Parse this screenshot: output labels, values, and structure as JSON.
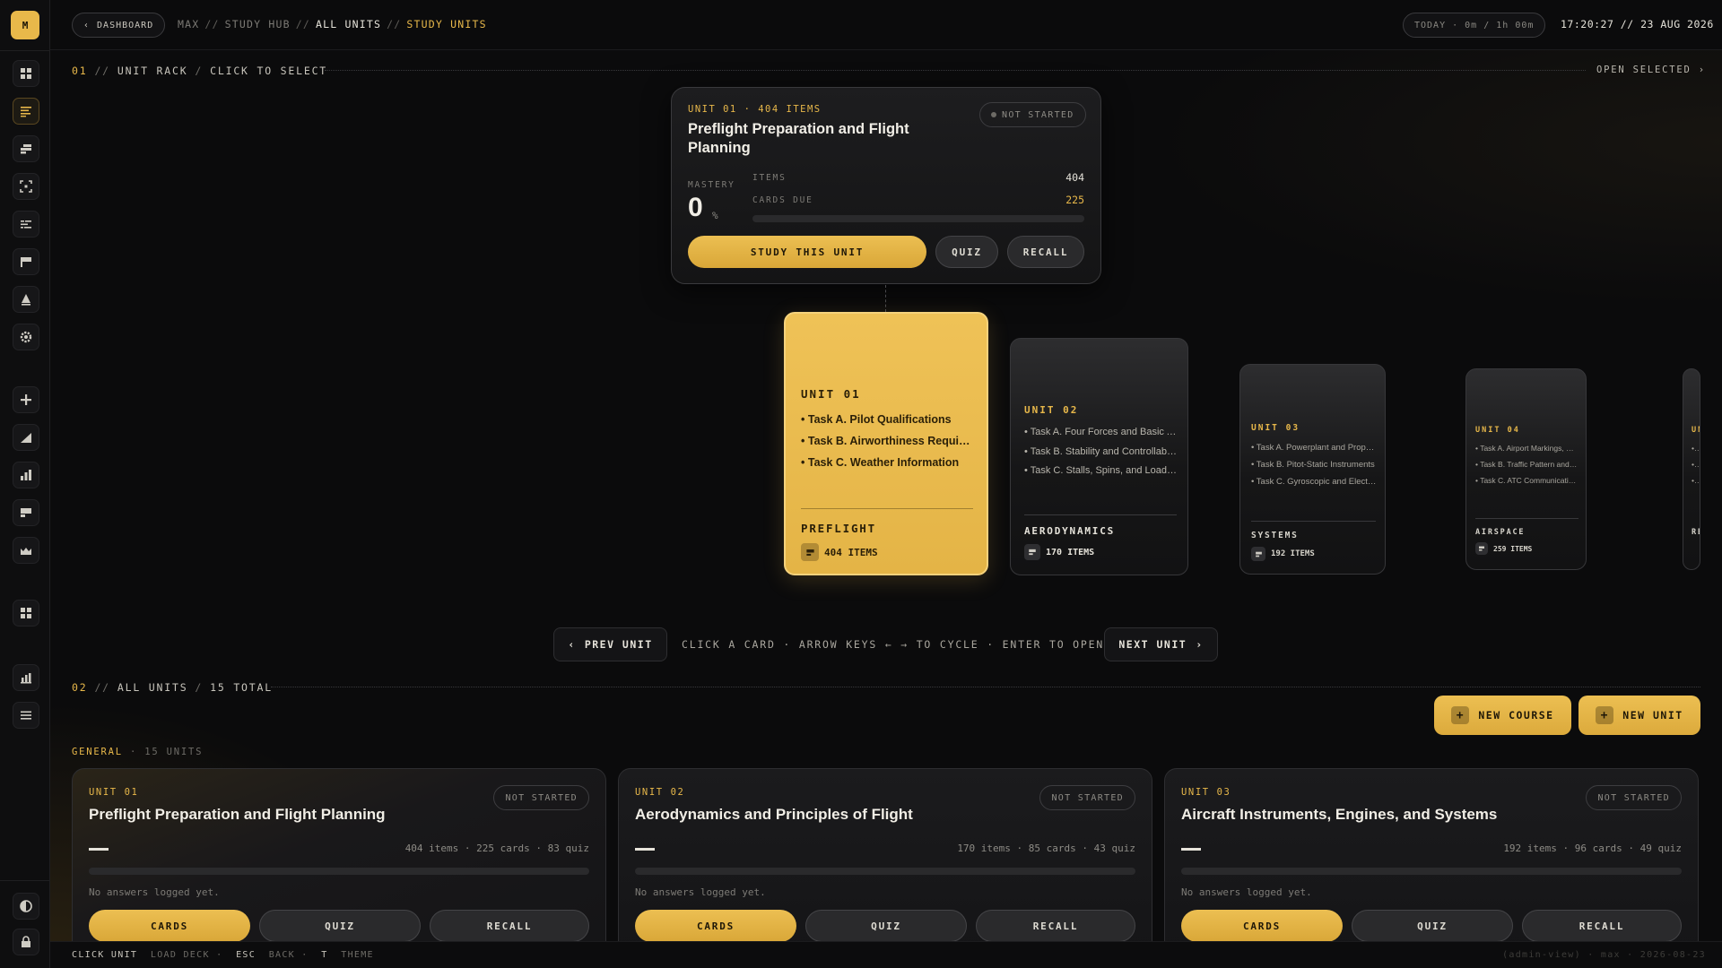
{
  "app": {
    "logo_letter": "M",
    "accent": "#e8b84a"
  },
  "topbar": {
    "back_label": "DASHBOARD",
    "crumbs": [
      "MAX",
      "STUDY HUB",
      "ALL UNITS",
      "STUDY UNITS"
    ],
    "today": "TODAY · 0m / 1h 00m",
    "clock": "17:20:27 // 23 AUG 2026"
  },
  "sidebar": {
    "items": [
      "grid-icon",
      "list-icon",
      "stack-icon",
      "focus-icon",
      "lines-icon",
      "flag-icon",
      "tree-icon",
      "gear-icon",
      "plus-icon",
      "ascending-chart-icon",
      "bar-chart-icon",
      "card-icon",
      "image-icon",
      "apps-icon",
      "stats-icon",
      "menu-icon",
      "contrast-icon",
      "lock-icon"
    ]
  },
  "rack_section": {
    "num": "01",
    "label": "UNIT RACK",
    "sub": "CLICK TO SELECT",
    "open_selected": "OPEN SELECTED ›"
  },
  "detail": {
    "eyebrow": "UNIT 01 · 404 ITEMS",
    "title": "Preflight Preparation and Flight Planning",
    "status": "NOT STARTED",
    "mastery_label": "MASTERY",
    "mastery_value": "0",
    "mastery_unit": "%",
    "items_label": "ITEMS",
    "items_value": "404",
    "due_label": "CARDS DUE",
    "due_value": "225",
    "progress": 0,
    "study_btn": "STUDY THIS UNIT",
    "quiz_btn": "QUIZ",
    "recall_btn": "RECALL"
  },
  "rack": [
    {
      "unit": "UNIT 01",
      "tasks": [
        "Task A. Pilot Qualifications",
        "Task B. Airworthiness Requirements",
        "Task C. Weather Information"
      ],
      "category": "PREFLIGHT",
      "items": "404 ITEMS"
    },
    {
      "unit": "UNIT 02",
      "tasks": [
        "Task A. Four Forces and Basic Aerodynamics",
        "Task B. Stability and Controllability",
        "Task C. Stalls, Spins, and Load Factor"
      ],
      "category": "AERODYNAMICS",
      "items": "170 ITEMS"
    },
    {
      "unit": "UNIT 03",
      "tasks": [
        "Task A. Powerplant and Propeller",
        "Task B. Pitot-Static Instruments",
        "Task C. Gyroscopic and Electrical Systems"
      ],
      "category": "SYSTEMS",
      "items": "192 ITEMS"
    },
    {
      "unit": "UNIT 04",
      "tasks": [
        "Task A. Airport Markings, Signs and Lighting",
        "Task B. Traffic Pattern and Airspace",
        "Task C. ATC Communications"
      ],
      "category": "AIRSPACE",
      "items": "259 ITEMS"
    },
    {
      "unit": "UN",
      "tasks": [
        "T",
        "T",
        "T"
      ],
      "category": "RE",
      "items": ""
    }
  ],
  "nav": {
    "prev": "PREV UNIT",
    "next": "NEXT UNIT",
    "hint": "CLICK A CARD · ARROW KEYS ← → TO CYCLE · ENTER TO OPEN"
  },
  "all_section": {
    "num": "02",
    "label": "ALL UNITS",
    "sub": "15 TOTAL",
    "new_course": "NEW COURSE",
    "new_unit": "NEW UNIT",
    "group": "GENERAL",
    "group_count": "· 15 UNITS"
  },
  "units": [
    {
      "num": "UNIT 01",
      "title": "Preflight Preparation and Flight Planning",
      "status": "NOT STARTED",
      "meta": "404 items · 225 cards · 83 quiz",
      "progress": 0,
      "note": "No answers logged yet.",
      "cards": "CARDS",
      "quiz": "QUIZ",
      "recall": "RECALL"
    },
    {
      "num": "UNIT 02",
      "title": "Aerodynamics and Principles of Flight",
      "status": "NOT STARTED",
      "meta": "170 items · 85 cards · 43 quiz",
      "progress": 0,
      "note": "No answers logged yet.",
      "cards": "CARDS",
      "quiz": "QUIZ",
      "recall": "RECALL"
    },
    {
      "num": "UNIT 03",
      "title": "Aircraft Instruments, Engines, and Systems",
      "status": "NOT STARTED",
      "meta": "192 items · 96 cards · 49 quiz",
      "progress": 0,
      "note": "No answers logged yet.",
      "cards": "CARDS",
      "quiz": "QUIZ",
      "recall": "RECALL"
    }
  ],
  "hints": {
    "k1": "CLICK UNIT",
    "t1": "LOAD DECK ·",
    "k2": "ESC",
    "t2": "BACK ·",
    "k3": "T",
    "t3": "THEME",
    "right": "(admin-view) · max · 2026-08-23"
  }
}
